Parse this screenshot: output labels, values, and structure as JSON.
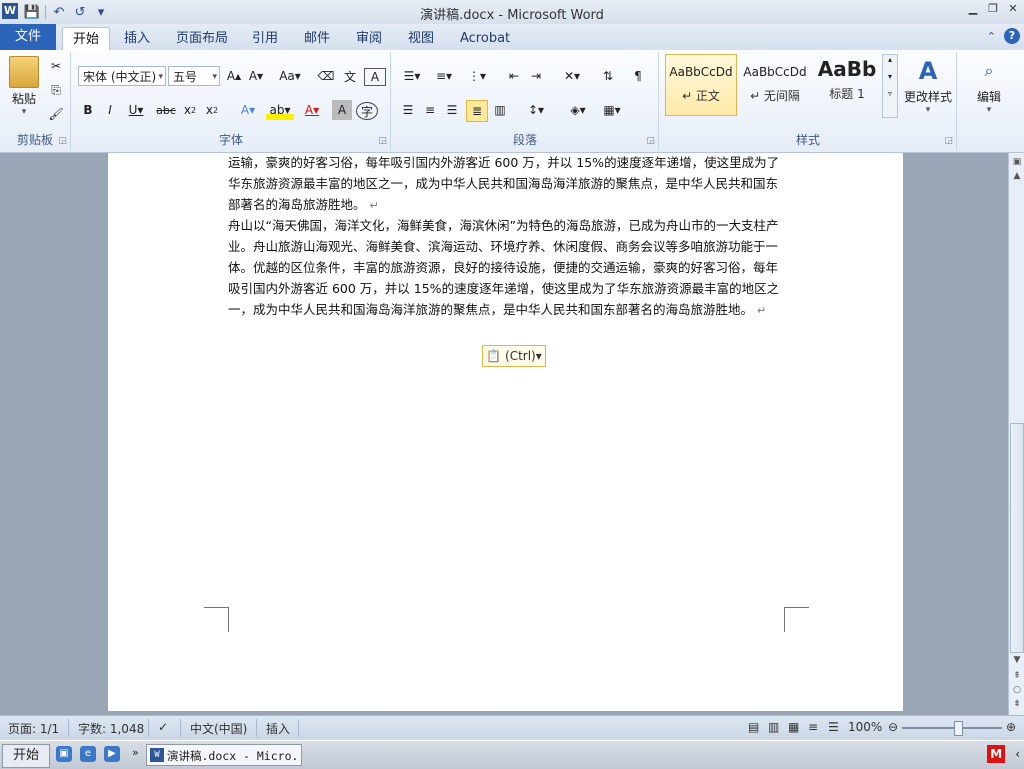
{
  "window": {
    "title": "演讲稿.docx - Microsoft Word"
  },
  "qat": {
    "save": "💾",
    "undo": "↶",
    "redo": "↺",
    "more": "▾"
  },
  "ribbon": {
    "file_tab": "文件",
    "tabs": [
      "开始",
      "插入",
      "页面布局",
      "引用",
      "邮件",
      "审阅",
      "视图",
      "Acrobat"
    ],
    "clipboard": {
      "paste": "粘贴",
      "label": "剪贴板"
    },
    "font": {
      "font_name": "宋体 (中文正)",
      "font_size": "五号",
      "label": "字体"
    },
    "paragraph": {
      "label": "段落"
    },
    "styles": {
      "label": "样式",
      "items": [
        {
          "sample": "AaBbCcDd",
          "name": "↵ 正文"
        },
        {
          "sample": "AaBbCcDd",
          "name": "↵ 无间隔"
        },
        {
          "sample": "AaBb",
          "name": "标题 1"
        }
      ],
      "change_styles": "更改样式"
    },
    "editing": {
      "label": "编辑"
    }
  },
  "document": {
    "paragraphs": [
      "运输，豪爽的好客习俗，每年吸引国内外游客近 600 万，并以 15%的速度逐年递增，使这里成为了华东旅游资源最丰富的地区之一，成为中华人民共和国海岛海洋旅游的聚焦点，是中华人民共和国东部著名的海岛旅游胜地。",
      "舟山以“海天佛国，海洋文化，海鲜美食，海滨休闲”为特色的海岛旅游，已成为舟山市的一大支柱产业。舟山旅游山海观光、海鲜美食、滨海运动、环境疗养、休闲度假、商务会议等多咱旅游功能于一体。优越的区位条件，丰富的旅游资源，良好的接待设施，便捷的交通运输，豪爽的好客习俗，每年吸引国内外游客近 600 万，并以 15%的速度逐年递增，使这里成为了华东旅游资源最丰富的地区之一，成为中华人民共和国海岛海洋旅游的聚焦点，是中华人民共和国东部著名的海岛旅游胜地。"
    ],
    "paste_options": "(Ctrl)▾"
  },
  "status": {
    "page": "页面: 1/1",
    "words": "字数: 1,048",
    "language": "中文(中国)",
    "mode": "插入",
    "zoom": "100%"
  },
  "taskbar": {
    "start": "开始",
    "task": "演讲稿.docx - Micro..."
  }
}
